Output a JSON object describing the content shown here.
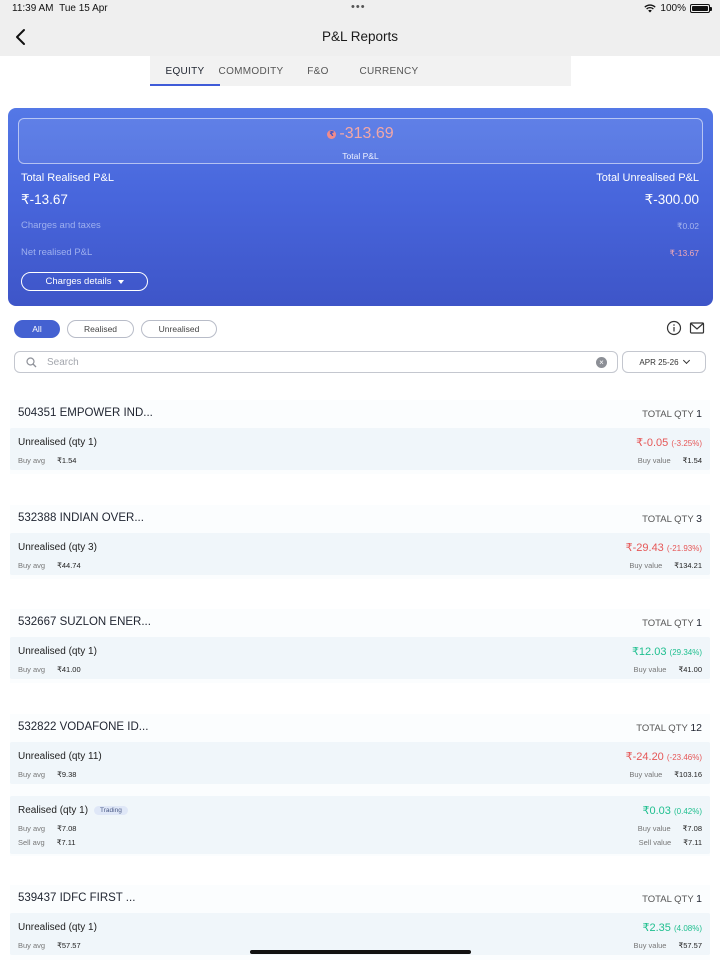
{
  "status_bar": {
    "time": "11:39 AM",
    "date": "Tue 15 Apr",
    "battery": "100%"
  },
  "header": {
    "title": "P&L Reports"
  },
  "tabs": [
    "EQUITY",
    "COMMODITY",
    "F&O",
    "CURRENCY"
  ],
  "summary": {
    "total_pnl": "-313.69",
    "total_pnl_label": "Total P&L",
    "realised_label": "Total Realised P&L",
    "realised_value": "₹-13.67",
    "unrealised_label": "Total Unrealised P&L",
    "unrealised_value": "₹-300.00",
    "charges_label": "Charges and taxes",
    "charges_value": "₹0.02",
    "net_label": "Net realised P&L",
    "net_value": "₹-13.67",
    "charges_button": "Charges details"
  },
  "filters": [
    "All",
    "Realised",
    "Unrealised"
  ],
  "search": {
    "placeholder": "Search"
  },
  "period": "APR 25-26",
  "labels": {
    "total_qty": "TOTAL QTY",
    "buy_avg": "Buy avg",
    "sell_avg": "Sell avg",
    "buy_value": "Buy value",
    "sell_value": "Sell value"
  },
  "holdings": [
    {
      "name": "504351 EMPOWER IND...",
      "qty": "1",
      "rows": [
        {
          "kind": "Unrealised (qty 1)",
          "pnl": "₹-0.05",
          "pct": "(-3.25%)",
          "buy_avg": "₹1.54",
          "buy_value": "₹1.54"
        }
      ]
    },
    {
      "name": "532388 INDIAN OVER...",
      "qty": "3",
      "rows": [
        {
          "kind": "Unrealised (qty 3)",
          "pnl": "₹-29.43",
          "pct": "(-21.93%)",
          "buy_avg": "₹44.74",
          "buy_value": "₹134.21"
        }
      ]
    },
    {
      "name": "532667 SUZLON ENER...",
      "qty": "1",
      "rows": [
        {
          "kind": "Unrealised (qty 1)",
          "pnl": "₹12.03",
          "pct": "(29.34%)",
          "buy_avg": "₹41.00",
          "buy_value": "₹41.00"
        }
      ]
    },
    {
      "name": "532822 VODAFONE ID...",
      "qty": "12",
      "rows": [
        {
          "kind": "Unrealised (qty 11)",
          "pnl": "₹-24.20",
          "pct": "(-23.46%)",
          "buy_avg": "₹9.38",
          "buy_value": "₹103.16"
        },
        {
          "kind": "Realised (qty 1)",
          "badge": "Trading",
          "pnl": "₹0.03",
          "pct": "(0.42%)",
          "buy_avg": "₹7.08",
          "buy_value": "₹7.08",
          "sell_avg": "₹7.11",
          "sell_value": "₹7.11"
        }
      ]
    },
    {
      "name": "539437 IDFC FIRST ...",
      "qty": "1",
      "rows": [
        {
          "kind": "Unrealised (qty 1)",
          "pnl": "₹2.35",
          "pct": "(4.08%)",
          "buy_avg": "₹57.57",
          "buy_value": "₹57.57"
        }
      ]
    }
  ],
  "colors": {
    "accent": "#4461d1",
    "negative": "#e65757",
    "positive": "#1fbf8f"
  }
}
